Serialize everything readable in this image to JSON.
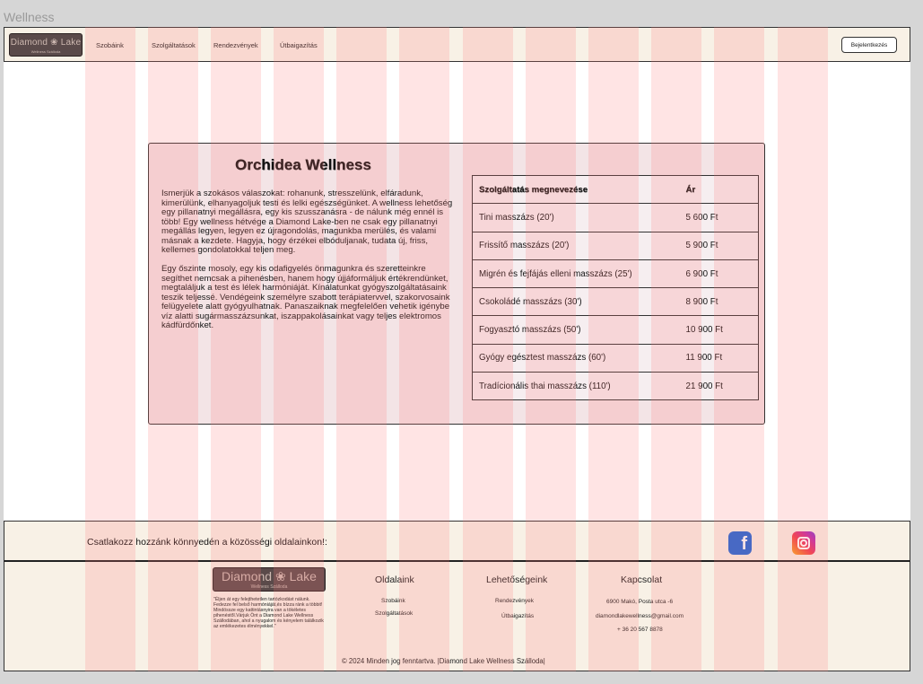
{
  "frame_title": "Wellness",
  "navbar": {
    "logo_main": "Diamond ❀ Lake",
    "logo_sub": "Wellness Szálloda",
    "links": [
      "Szobáink",
      "Szolgáltatások",
      "Rendezvények",
      "Útbaigazítás"
    ],
    "login_label": "Bejelentkezés"
  },
  "card": {
    "title": "Orchidea Wellness",
    "paragraph1": "Ismerjük a szokásos válaszokat: rohanunk, stresszelünk, elfáradunk, kimerülünk, elhanyagoljuk testi és lelki egészségünket. A wellness lehetőség egy pillanatnyi megállásra, egy kis szusszanásra - de nálunk még ennél is több! Egy wellness hétvége a Diamond Lake-ben ne csak egy pillanatnyi megállás legyen, legyen ez újragondolás, magunkba merülés, és valami másnak a kezdete. Hagyja, hogy érzékei elbóduljanak, tudata új, friss, kellemes gondolatokkal teljen meg.",
    "paragraph2": "Egy őszinte mosoly, egy kis odafigyelés önmagunkra és szeretteinkre segíthet nemcsak a pihenésben, hanem hogy újjáformáljuk értékrendünket, megtaláljuk a test és lélek harmóniáját. Kínálatunkat gyógyszolgáltatásaink teszik teljessé. Vendégeink személyre szabott terápiatervvel, szakorvosaink felügyelete alatt gyógyulhatnak. Panaszaiknak megfelelően vehetik igénybe víz alatti sugármasszázsunkat, iszappakolásainkat vagy teljes elektromos kádfürdőnket."
  },
  "price_table": {
    "headers": [
      "Szolgáltatás megnevezése",
      "Ár"
    ],
    "rows": [
      {
        "name": "Tini masszázs (20')",
        "price": "5 600 Ft"
      },
      {
        "name": "Frissítő masszázs (20')",
        "price": "5 900 Ft"
      },
      {
        "name": "Migrén és fejfájás elleni masszázs (25')",
        "price": "6 900 Ft"
      },
      {
        "name": "Csokoládé masszázs (30')",
        "price": "8 900 Ft"
      },
      {
        "name": "Fogyasztó masszázs (50')",
        "price": "10 900 Ft"
      },
      {
        "name": "Gyógy egésztest masszázs (60')",
        "price": "11 900 Ft"
      },
      {
        "name": "Tradícionális thai masszázs (110')",
        "price": "21 900 Ft"
      }
    ]
  },
  "social": {
    "text": "Csatlakozz hozzánk könnyedén a közösségi oldalainkon!:",
    "facebook_glyph": "f",
    "facebook_icon": "facebook-icon",
    "instagram_icon": "instagram-icon"
  },
  "footer": {
    "logo_main": "Diamond ❀ Lake",
    "logo_sub": "Wellness Szálloda",
    "tagline": "\"Éljen át egy felejthetetlen tartózkodást nálunk. Fedezze fel belső harmóniáját,és bízza ránk a többit! Mindössze egy kattintásnyira van a tökéletes pihenéstől.Várjuk Önt a Diamond Lake Wellness Szállodában, ahol a nyugalom és kényelem találkozik az emlékezetes élményekkel.\"",
    "headings": {
      "pages": "Oldalaink",
      "options": "Lehetőségeink",
      "contact": "Kapcsolat"
    },
    "pages_links": [
      "Szobáink",
      "Szolgáltatások"
    ],
    "options_links": [
      "Rendezvények",
      "Útbaigazítás"
    ],
    "contact": {
      "address": "6900 Makó, Posta  utca -6",
      "email": "diamondlakewellness@gmail.com",
      "phone": "+ 36 20 567 8878"
    },
    "copyright": "© 2024 Minden jog fenntartva. |Diamond Lake Wellness Szálloda|"
  },
  "colors": {
    "page_bg": "#ffffff",
    "cream": "#f8f1e6",
    "card_bg": "#f3e4e6",
    "logo_bg": "#5a4a4a",
    "grid_overlay": "#ff7878",
    "facebook": "#1b66d8"
  }
}
